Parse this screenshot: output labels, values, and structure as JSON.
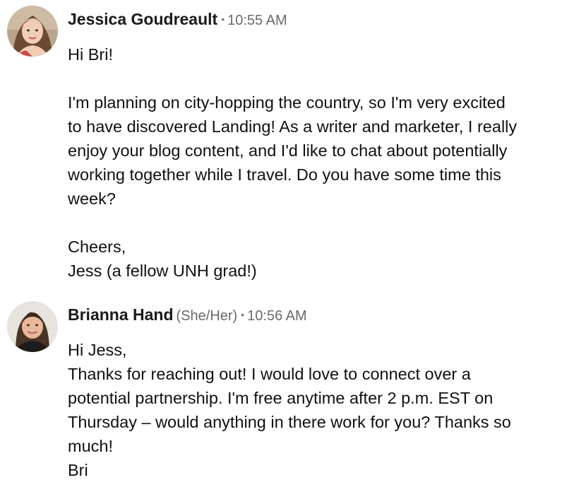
{
  "messages": [
    {
      "sender": "Jessica Goudreault",
      "pronouns": "",
      "separator": "•",
      "time": "10:55 AM",
      "avatar_icon": "profile-photo-woman-brown-hair",
      "lines": [
        "Hi Bri!",
        "",
        "I'm planning on city-hopping the country, so I'm very excited",
        "to have discovered Landing! As a writer and marketer, I really",
        "enjoy your blog content, and I'd like to chat about potentially",
        "working together while I travel. Do you have some time this",
        "week?",
        "",
        "Cheers,",
        "Jess (a fellow UNH grad!)"
      ]
    },
    {
      "sender": "Brianna Hand",
      "pronouns": "(She/Her)",
      "separator": "•",
      "time": "10:56 AM",
      "avatar_icon": "profile-photo-woman-smiling",
      "lines": [
        "Hi Jess,",
        "Thanks for reaching out! I would love to connect over a",
        "potential partnership. I'm free anytime after 2 p.m. EST on",
        "Thursday – would anything in there work for you? Thanks so",
        "much!",
        "Bri"
      ]
    }
  ]
}
